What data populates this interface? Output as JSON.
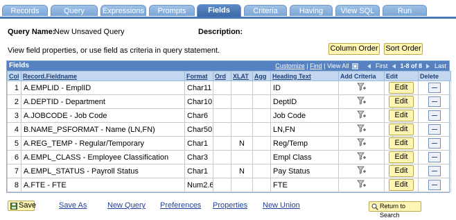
{
  "tabs": [
    "Records",
    "Query",
    "Expressions",
    "Prompts",
    "Fields",
    "Criteria",
    "Having",
    "View SQL",
    "Run"
  ],
  "active_tab": "Fields",
  "query_name_label": "Query Name:",
  "query_name_value": "New Unsaved Query",
  "description_label": "Description:",
  "instructions": "View field properties, or use field as criteria in query statement.",
  "column_order_button": "Column Order",
  "sort_order_button": "Sort Order",
  "grid": {
    "title": "Fields",
    "customize": "Customize",
    "find": "Find",
    "view_all": "View All",
    "first": "First",
    "range": "1-8 of 8",
    "last": "Last",
    "columns": [
      "Col",
      "Record.Fieldname",
      "Format",
      "Ord",
      "XLAT",
      "Agg",
      "Heading Text",
      "Add Criteria",
      "Edit",
      "Delete"
    ],
    "edit_label": "Edit",
    "rows": [
      {
        "col": "1",
        "field": "A.EMPLID - EmplID",
        "format": "Char11",
        "ord": "",
        "xlat": "",
        "agg": "",
        "heading": "ID"
      },
      {
        "col": "2",
        "field": "A.DEPTID - Department",
        "format": "Char10",
        "ord": "",
        "xlat": "",
        "agg": "",
        "heading": "DeptID"
      },
      {
        "col": "3",
        "field": "A.JOBCODE - Job Code",
        "format": "Char6",
        "ord": "",
        "xlat": "",
        "agg": "",
        "heading": "Job Code"
      },
      {
        "col": "4",
        "field": "B.NAME_PSFORMAT - Name (LN,FN)",
        "format": "Char50",
        "ord": "",
        "xlat": "",
        "agg": "",
        "heading": "LN,FN"
      },
      {
        "col": "5",
        "field": "A.REG_TEMP - Regular/Temporary",
        "format": "Char1",
        "ord": "",
        "xlat": "N",
        "agg": "",
        "heading": "Reg/Temp"
      },
      {
        "col": "6",
        "field": "A.EMPL_CLASS - Employee Classification",
        "format": "Char3",
        "ord": "",
        "xlat": "",
        "agg": "",
        "heading": "Empl Class"
      },
      {
        "col": "7",
        "field": "A.EMPL_STATUS - Payroll Status",
        "format": "Char1",
        "ord": "",
        "xlat": "N",
        "agg": "",
        "heading": "Pay Status"
      },
      {
        "col": "8",
        "field": "A.FTE - FTE",
        "format": "Num2.6",
        "ord": "",
        "xlat": "",
        "agg": "",
        "heading": "FTE"
      }
    ]
  },
  "bottom": {
    "save": "Save",
    "save_as": "Save As",
    "new_query": "New Query",
    "preferences": "Preferences",
    "properties": "Properties",
    "new_union": "New Union",
    "return_to_search": "Return to Search"
  },
  "colors": {
    "tab": "#7aa6d6",
    "tab_active": "#3d6aa8",
    "grid_header": "#5682c2",
    "button": "#fff5b4"
  }
}
